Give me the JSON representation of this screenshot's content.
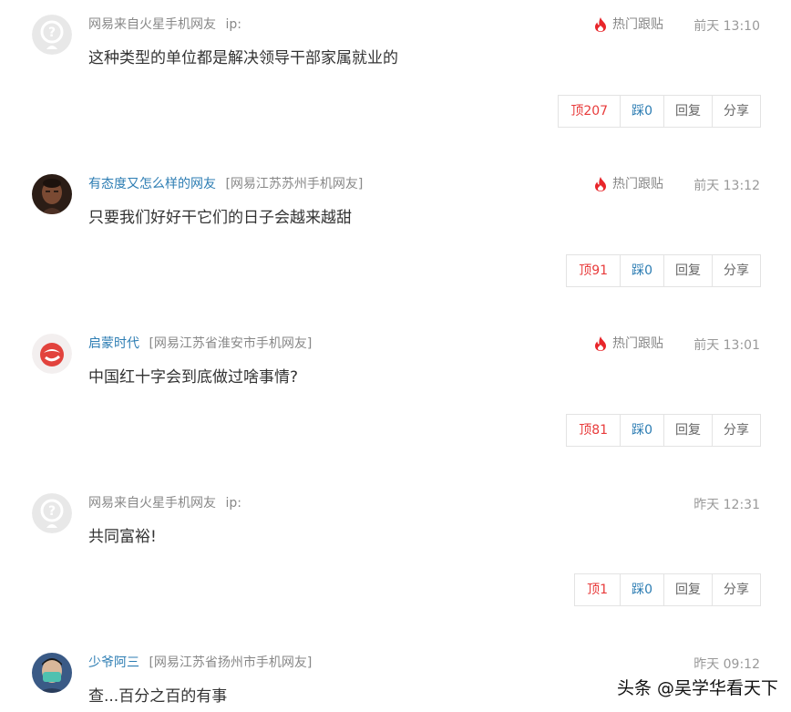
{
  "comments": [
    {
      "username": "网易来自火星手机网友",
      "user_suffix": "ip:",
      "location": "",
      "content": "这种类型的单位都是解决领导干部家属就业的",
      "hot_label": "热门跟贴",
      "time": "前天 13:10",
      "up_label": "顶207",
      "down_label": "踩0",
      "reply_label": "回复",
      "share_label": "分享",
      "avatar_icon": "anonymous-avatar-icon"
    },
    {
      "username": "有态度又怎么样的网友",
      "user_suffix": "",
      "location": "[网易江苏苏州手机网友]",
      "content": "只要我们好好干它们的日子会越来越甜",
      "hot_label": "热门跟贴",
      "time": "前天 13:12",
      "up_label": "顶91",
      "down_label": "踩0",
      "reply_label": "回复",
      "share_label": "分享",
      "avatar_icon": "user-photo-avatar"
    },
    {
      "username": "启蒙时代",
      "user_suffix": "",
      "location": "[网易江苏省淮安市手机网友]",
      "content": "中国红十字会到底做过啥事情?",
      "hot_label": "热门跟贴",
      "time": "前天 13:01",
      "up_label": "顶81",
      "down_label": "踩0",
      "reply_label": "回复",
      "share_label": "分享",
      "avatar_icon": "red-logo-avatar"
    },
    {
      "username": "网易来自火星手机网友",
      "user_suffix": "ip:",
      "location": "",
      "content": "共同富裕!",
      "hot_label": "",
      "time": "昨天 12:31",
      "up_label": "顶1",
      "down_label": "踩0",
      "reply_label": "回复",
      "share_label": "分享",
      "avatar_icon": "anonymous-avatar-icon"
    },
    {
      "username": "少爷阿三",
      "user_suffix": "",
      "location": "[网易江苏省扬州市手机网友]",
      "content": "查...百分之百的有事",
      "hot_label": "",
      "time": "昨天 09:12",
      "avatar_icon": "masked-user-avatar"
    }
  ],
  "watermark": "头条 @吴学华看天下",
  "colors": {
    "link_blue": "#2d7db3",
    "up_red": "#e83b3b",
    "fire_red": "#e8262b",
    "meta_gray": "#888888"
  }
}
